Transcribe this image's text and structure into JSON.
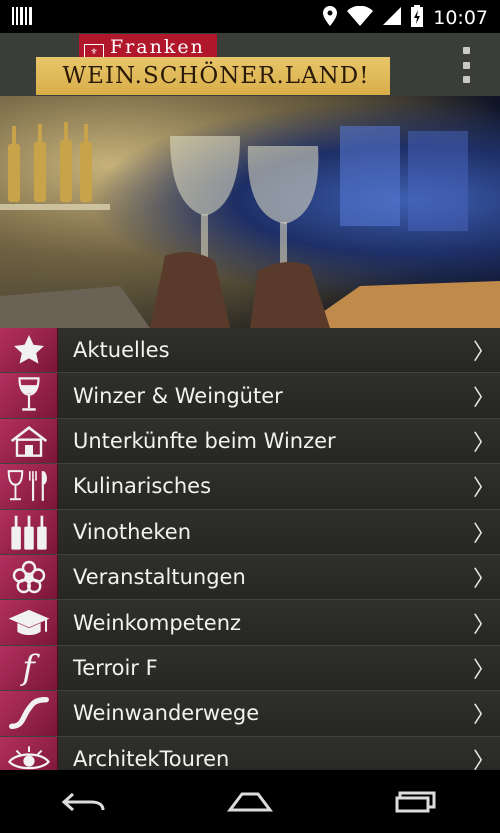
{
  "status_bar": {
    "time": "10:07"
  },
  "header": {
    "logo_top": "Franken",
    "logo_main": "WEIN.SCHÖNER.LAND!"
  },
  "menu": [
    {
      "label": "Aktuelles",
      "icon": "star-icon"
    },
    {
      "label": "Winzer & Weingüter",
      "icon": "wine-glass-icon"
    },
    {
      "label": "Unterkünfte beim Winzer",
      "icon": "house-icon"
    },
    {
      "label": "Kulinarisches",
      "icon": "cutlery-icon"
    },
    {
      "label": "Vinotheken",
      "icon": "bottles-icon"
    },
    {
      "label": "Veranstaltungen",
      "icon": "flower-icon"
    },
    {
      "label": "Weinkompetenz",
      "icon": "graduation-cap-icon"
    },
    {
      "label": "Terroir F",
      "icon": "f-icon"
    },
    {
      "label": "Weinwanderwege",
      "icon": "path-icon"
    },
    {
      "label": "ArchitekTouren",
      "icon": "eye-icon"
    }
  ],
  "colors": {
    "accent": "#9c1f47",
    "logo_red": "#b0172b",
    "logo_gold": "#d9ae4a"
  }
}
